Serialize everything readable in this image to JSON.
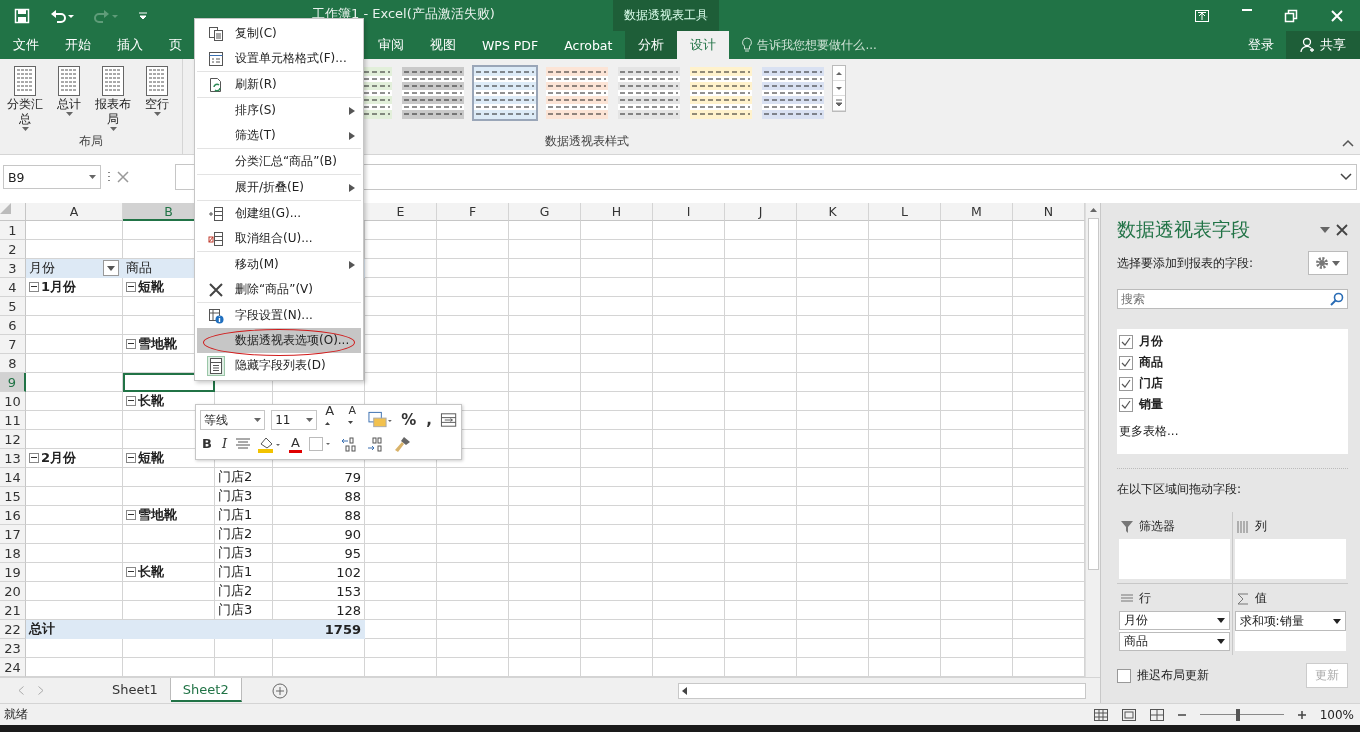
{
  "window": {
    "title": "工作簿1 - Excel(产品激活失败)",
    "context_label": "数据透视表工具"
  },
  "ribbon_tabs": [
    {
      "label": "文件",
      "selected": false
    },
    {
      "label": "开始",
      "selected": false
    },
    {
      "label": "插入",
      "selected": false
    },
    {
      "label": "页",
      "selected": false
    },
    {
      "label": "审阅",
      "selected": false
    },
    {
      "label": "视图",
      "selected": false
    },
    {
      "label": "WPS PDF",
      "selected": false
    },
    {
      "label": "Acrobat",
      "selected": false
    },
    {
      "label": "分析",
      "selected": false
    },
    {
      "label": "设计",
      "selected": true
    }
  ],
  "tell_me": {
    "placeholder": "告诉我您想要做什么..."
  },
  "account": {
    "sign_in": "登录",
    "share": "共享"
  },
  "layout_group": {
    "label": "布局",
    "buttons": [
      {
        "label": "分类汇总"
      },
      {
        "label": "总计"
      },
      {
        "label": "报表布局"
      },
      {
        "label": "空行"
      }
    ]
  },
  "styles_group": {
    "label": "数据透视表样式",
    "styles": [
      {
        "color": "#e2efda",
        "selected": false
      },
      {
        "color": "#c9c9c9",
        "selected": false
      },
      {
        "color": "#ddebf7",
        "selected": true
      },
      {
        "color": "#fce4d6",
        "selected": false
      },
      {
        "color": "#e4e4e4",
        "selected": false
      },
      {
        "color": "#fff2cc",
        "selected": false
      },
      {
        "color": "#d9e1f2",
        "selected": false
      }
    ]
  },
  "formula_bar": {
    "name_box": "B9"
  },
  "columns": [
    {
      "label": "A",
      "selected": false
    },
    {
      "label": "B",
      "selected": true
    },
    {},
    {},
    {
      "label": "E",
      "selected": false
    },
    {
      "label": "F",
      "selected": false
    },
    {
      "label": "G",
      "selected": false
    },
    {
      "label": "H",
      "selected": false
    },
    {
      "label": "I",
      "selected": false
    },
    {
      "label": "J",
      "selected": false
    },
    {
      "label": "K",
      "selected": false
    },
    {
      "label": "L",
      "selected": false
    },
    {
      "label": "M",
      "selected": false
    },
    {
      "label": "N",
      "selected": false
    }
  ],
  "rows": [
    {
      "n": "1",
      "kind": "blank",
      "selected": false,
      "cells": []
    },
    {
      "n": "2",
      "kind": "blank",
      "selected": false,
      "cells": []
    },
    {
      "n": "3",
      "kind": "header",
      "selected": false,
      "cells": [
        {
          "text": "月份",
          "filter_button": true
        },
        {
          "text": "商品"
        }
      ]
    },
    {
      "n": "4",
      "kind": "item",
      "selected": false,
      "cells": [
        {
          "text": "1月份",
          "expanded": true
        },
        {
          "text": "短靴",
          "expanded": true
        }
      ]
    },
    {
      "n": "5",
      "kind": "item",
      "selected": false,
      "cells": []
    },
    {
      "n": "6",
      "kind": "item",
      "selected": false,
      "cells": []
    },
    {
      "n": "7",
      "kind": "item",
      "selected": false,
      "cells": [
        null,
        {
          "text": "雪地靴",
          "expanded": true
        }
      ]
    },
    {
      "n": "8",
      "kind": "item",
      "selected": false,
      "cells": []
    },
    {
      "n": "9",
      "kind": "item",
      "selected": true,
      "cells": []
    },
    {
      "n": "10",
      "kind": "item",
      "selected": false,
      "cells": [
        null,
        {
          "text": "长靴",
          "expanded": true
        }
      ]
    },
    {
      "n": "11",
      "kind": "item",
      "selected": false,
      "cells": []
    },
    {
      "n": "12",
      "kind": "item",
      "selected": false,
      "cells": []
    },
    {
      "n": "13",
      "kind": "item",
      "selected": false,
      "cells": [
        {
          "text": "2月份",
          "expanded": true
        },
        {
          "text": "短靴",
          "expanded": true
        }
      ]
    },
    {
      "n": "14",
      "kind": "item",
      "selected": false,
      "cells": [
        null,
        null,
        {
          "text": "门店2"
        },
        {
          "text": "79"
        }
      ]
    },
    {
      "n": "15",
      "kind": "item",
      "selected": false,
      "cells": [
        null,
        null,
        {
          "text": "门店3"
        },
        {
          "text": "88"
        }
      ]
    },
    {
      "n": "16",
      "kind": "item",
      "selected": false,
      "cells": [
        null,
        {
          "text": "雪地靴",
          "expanded": true
        },
        {
          "text": "门店1"
        },
        {
          "text": "88"
        }
      ]
    },
    {
      "n": "17",
      "kind": "item",
      "selected": false,
      "cells": [
        null,
        null,
        {
          "text": "门店2"
        },
        {
          "text": "90"
        }
      ]
    },
    {
      "n": "18",
      "kind": "item",
      "selected": false,
      "cells": [
        null,
        null,
        {
          "text": "门店3"
        },
        {
          "text": "95"
        }
      ]
    },
    {
      "n": "19",
      "kind": "item",
      "selected": false,
      "cells": [
        null,
        {
          "text": "长靴",
          "expanded": true
        },
        {
          "text": "门店1"
        },
        {
          "text": "102"
        }
      ]
    },
    {
      "n": "20",
      "kind": "item",
      "selected": false,
      "cells": [
        null,
        null,
        {
          "text": "门店2"
        },
        {
          "text": "153"
        }
      ]
    },
    {
      "n": "21",
      "kind": "item",
      "selected": false,
      "cells": [
        null,
        null,
        {
          "text": "门店3"
        },
        {
          "text": "128"
        }
      ]
    },
    {
      "n": "22",
      "kind": "total",
      "selected": false,
      "cells": [
        {
          "text": "总计"
        },
        null,
        null,
        {
          "text": "1759"
        }
      ]
    },
    {
      "n": "23",
      "kind": "blank",
      "selected": false,
      "cells": []
    },
    {
      "n": "24",
      "kind": "blank",
      "selected": false,
      "cells": []
    }
  ],
  "context_menu": [
    {
      "kind": "copy",
      "label": "复制(C)",
      "submenu": false,
      "selected": false,
      "divider_after": false
    },
    {
      "kind": "format",
      "label": "设置单元格格式(F)...",
      "submenu": false,
      "selected": false,
      "divider_after": true
    },
    {
      "kind": "refresh",
      "label": "刷新(R)",
      "submenu": false,
      "selected": false,
      "divider_after": true
    },
    {
      "kind": "plain",
      "label": "排序(S)",
      "submenu": true,
      "selected": false,
      "divider_after": false
    },
    {
      "kind": "plain",
      "label": "筛选(T)",
      "submenu": true,
      "selected": false,
      "divider_after": true
    },
    {
      "kind": "plain",
      "label": "分类汇总“商品”(B)",
      "submenu": false,
      "selected": false,
      "divider_after": true
    },
    {
      "kind": "plain",
      "label": "展开/折叠(E)",
      "submenu": true,
      "selected": false,
      "divider_after": true
    },
    {
      "kind": "group",
      "label": "创建组(G)...",
      "submenu": false,
      "selected": false,
      "divider_after": false
    },
    {
      "kind": "ungroup",
      "label": "取消组合(U)...",
      "submenu": false,
      "selected": false,
      "divider_after": true
    },
    {
      "kind": "plain",
      "label": "移动(M)",
      "submenu": true,
      "selected": false,
      "divider_after": false
    },
    {
      "kind": "delete",
      "label": "删除“商品”(V)",
      "submenu": false,
      "selected": false,
      "divider_after": true
    },
    {
      "kind": "field-settings",
      "label": "字段设置(N)...",
      "submenu": false,
      "selected": false,
      "divider_after": false
    },
    {
      "kind": "plain",
      "label": "数据透视表选项(O)...",
      "submenu": false,
      "selected": true,
      "divider_after": false
    },
    {
      "kind": "field-list",
      "label": "隐藏字段列表(D)",
      "submenu": false,
      "selected": false,
      "divider_after": false
    }
  ],
  "mini_toolbar": {
    "font": "等线",
    "size": "11",
    "row1": [
      {
        "kind": "grow",
        "label": "A"
      },
      {
        "kind": "shrink",
        "label": "A"
      },
      {
        "kind": "styles"
      },
      {
        "kind": "percent",
        "label": "%"
      },
      {
        "kind": "comma",
        "label": ","
      },
      {
        "kind": "wrap"
      }
    ],
    "row2": [
      {
        "kind": "bold",
        "label": "B"
      },
      {
        "kind": "italic",
        "label": "I"
      },
      {
        "kind": "align"
      },
      {
        "kind": "fill"
      },
      {
        "kind": "fontcolor",
        "label": "A"
      },
      {
        "kind": "border"
      },
      {
        "kind": "inc-decimal"
      },
      {
        "kind": "dec-decimal"
      },
      {
        "kind": "painter"
      }
    ]
  },
  "sheet_tabs": [
    {
      "label": "Sheet1",
      "selected": false
    },
    {
      "label": "Sheet2",
      "selected": true
    }
  ],
  "status_bar": {
    "text": "就绪",
    "zoom": "100%",
    "level": 0.45
  },
  "field_pane": {
    "title": "数据透视表字段",
    "prompt": "选择要添加到报表的字段:",
    "search": {
      "placeholder": "搜索"
    },
    "fields": [
      {
        "label": "月份",
        "checked": true
      },
      {
        "label": "商品",
        "checked": true
      },
      {
        "label": "门店",
        "checked": true
      },
      {
        "label": "销量",
        "checked": true
      }
    ],
    "more_tables": "更多表格...",
    "areas_prompt": "在以下区域间拖动字段:",
    "areas": [
      {
        "kind": "filter",
        "label": "筛选器"
      },
      {
        "kind": "columns",
        "label": "列"
      },
      {
        "kind": "rows",
        "label": "行",
        "items": [
          "月份",
          "商品"
        ]
      },
      {
        "kind": "values",
        "label": "值",
        "items": [
          "求和项:销量"
        ]
      }
    ],
    "defer": {
      "label": "推迟布局更新",
      "checked": false
    },
    "update_button": {
      "label": "更新",
      "disabled": true
    }
  }
}
